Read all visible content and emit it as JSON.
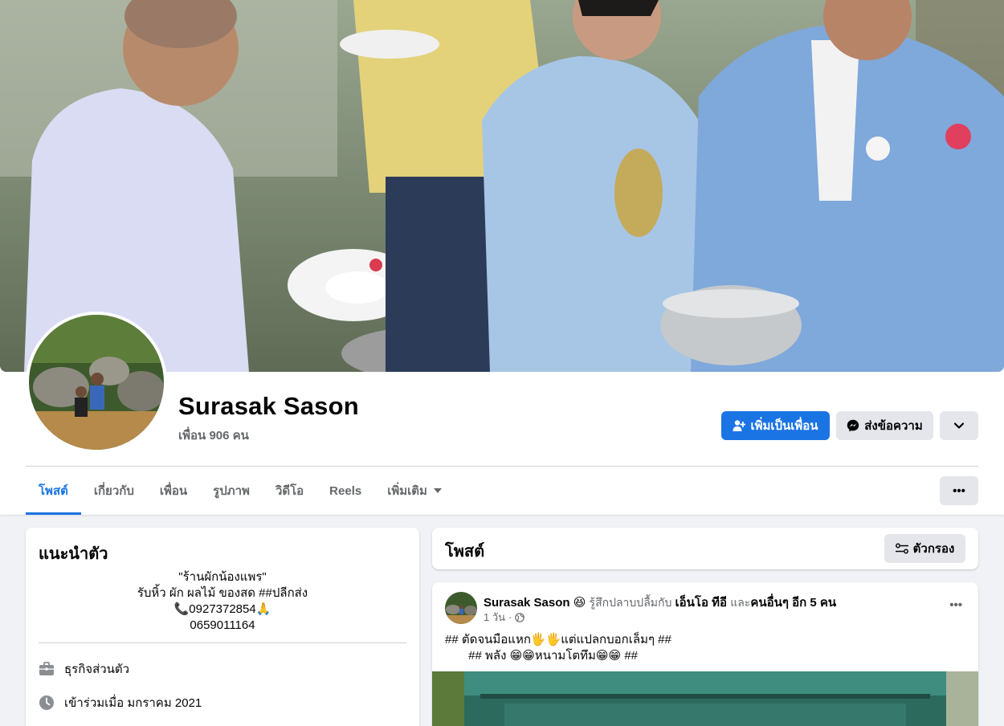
{
  "profile": {
    "name": "Surasak Sason",
    "friends_count": "เพื่อน 906 คน"
  },
  "actions": {
    "add_friend": "เพิ่มเป็นเพื่อน",
    "message": "ส่งข้อความ"
  },
  "tabs": [
    {
      "label": "โพสต์",
      "active": true
    },
    {
      "label": "เกี่ยวกับ"
    },
    {
      "label": "เพื่อน"
    },
    {
      "label": "รูปภาพ"
    },
    {
      "label": "วิดีโอ"
    },
    {
      "label": "Reels"
    },
    {
      "label": "เพิ่มเติม"
    }
  ],
  "intro": {
    "title": "แนะนำตัว",
    "bio_lines": [
      "\"ร้านผักน้องแพร\"",
      "รับหิ้ว ผัก ผลไม้ ของสด ##ปลีกส่ง",
      "📞0927372854🙏",
      "0659011164"
    ],
    "work": "ธุรกิจส่วนตัว",
    "joined": "เข้าร่วมเมื่อ มกราคม 2021"
  },
  "posts_header": {
    "title": "โพสต์",
    "filter_label": "ตัวกรอง"
  },
  "post": {
    "author": "Surasak Sason",
    "feeling_emoji": "😆",
    "feeling": "รู้สึกปลาบปลื้มกับ",
    "tagged": "เอ็นโอ ทีอี",
    "and_word": "และ",
    "others": "คนอื่นๆ อีก 5 คน",
    "time": "1 วัน",
    "text_line1": "## ตัดจนมือแหก🖐🖐แต่แปลกบอกเล็มๆ ##",
    "text_line2": "       ## พลัง 😁😁หนามโตทึม😁😁 ##"
  },
  "colors": {
    "accent": "#1b74e4",
    "secondary_button": "#e4e6eb",
    "page_bg": "#f0f2f5",
    "muted_text": "#65676b"
  }
}
